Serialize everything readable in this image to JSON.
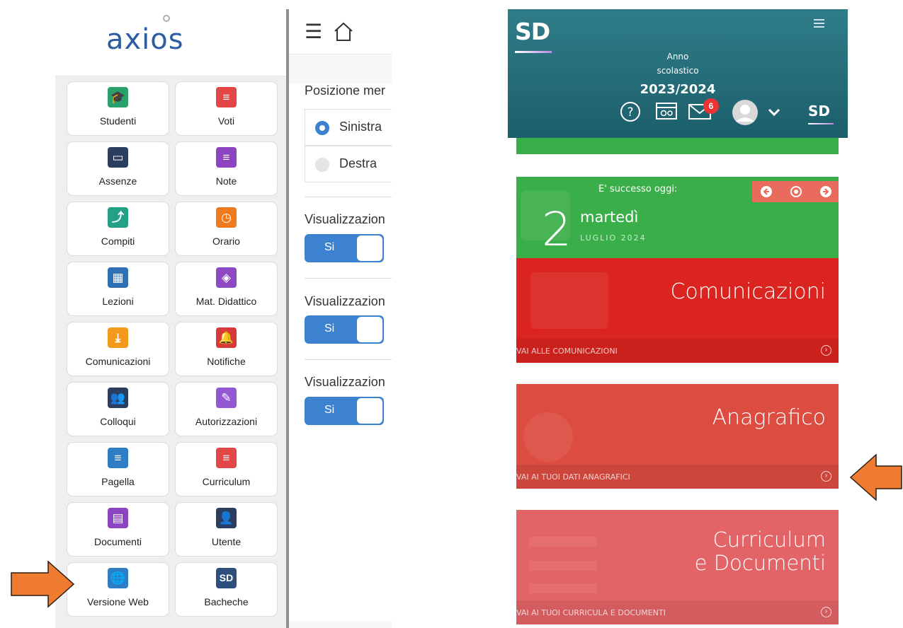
{
  "left_app": {
    "logo_text": "axios",
    "tiles": [
      {
        "label": "Studenti",
        "color": "#2aa06d",
        "glyph": "🎓"
      },
      {
        "label": "Voti",
        "color": "#e34646",
        "glyph": "≡"
      },
      {
        "label": "Assenze",
        "color": "#2c3e60",
        "glyph": "▭"
      },
      {
        "label": "Note",
        "color": "#8c44c1",
        "glyph": "≡"
      },
      {
        "label": "Compiti",
        "color": "#23a086",
        "glyph": "⤴"
      },
      {
        "label": "Orario",
        "color": "#f07b1e",
        "glyph": "◷"
      },
      {
        "label": "Lezioni",
        "color": "#2f6fb3",
        "glyph": "▦"
      },
      {
        "label": "Mat. Didattico",
        "color": "#8d4ac2",
        "glyph": "◈"
      },
      {
        "label": "Comunicazioni",
        "color": "#f39a1d",
        "glyph": "⤓"
      },
      {
        "label": "Notifiche",
        "color": "#d83a3a",
        "glyph": "🔔"
      },
      {
        "label": "Colloqui",
        "color": "#2c3e60",
        "glyph": "👥"
      },
      {
        "label": "Autorizzazioni",
        "color": "#9358d1",
        "glyph": "✎"
      },
      {
        "label": "Pagella",
        "color": "#2f7ec5",
        "glyph": "≡"
      },
      {
        "label": "Curriculum",
        "color": "#e34646",
        "glyph": "≡"
      },
      {
        "label": "Documenti",
        "color": "#8c44c1",
        "glyph": "▤"
      },
      {
        "label": "Utente",
        "color": "#2c3e60",
        "glyph": "👤"
      },
      {
        "label": "Versione Web",
        "color": "#2f7ec5",
        "glyph": "🌐"
      },
      {
        "label": "Bacheche",
        "color": "#2c4f7c",
        "glyph": "SD"
      }
    ],
    "settings": {
      "menu_position_title": "Posizione mer",
      "option_left": "Sinistra",
      "option_right": "Destra",
      "visual_title_1": "Visualizzazion",
      "visual_title_2": "Visualizzazion",
      "visual_title_3": "Visualizzazion",
      "toggle_label": "Si"
    }
  },
  "right_app": {
    "logo": "SD",
    "school_year_label_1": "Anno",
    "school_year_label_2": "scolastico",
    "school_year": "2023/2024",
    "messages_badge": "6",
    "small_logo": "SD",
    "today": {
      "label": "E' successo oggi:",
      "day_number": "2",
      "day_name": "martedì",
      "month_year": "LUGLIO 2024"
    },
    "cards": {
      "comunicazioni_title": "Comunicazioni",
      "comunicazioni_link": "VAI ALLE COMUNICAZIONI",
      "anagrafico_title": "Anagrafico",
      "anagrafico_link": "VAI AI TUOI DATI ANAGRAFICI",
      "curriculum_title_1": "Curriculum",
      "curriculum_title_2": "e Documenti",
      "curriculum_link": "VAI AI TUOI CURRICULA E DOCUMENTI"
    }
  },
  "annotations": {
    "arrow_color": "#ee7b30"
  }
}
